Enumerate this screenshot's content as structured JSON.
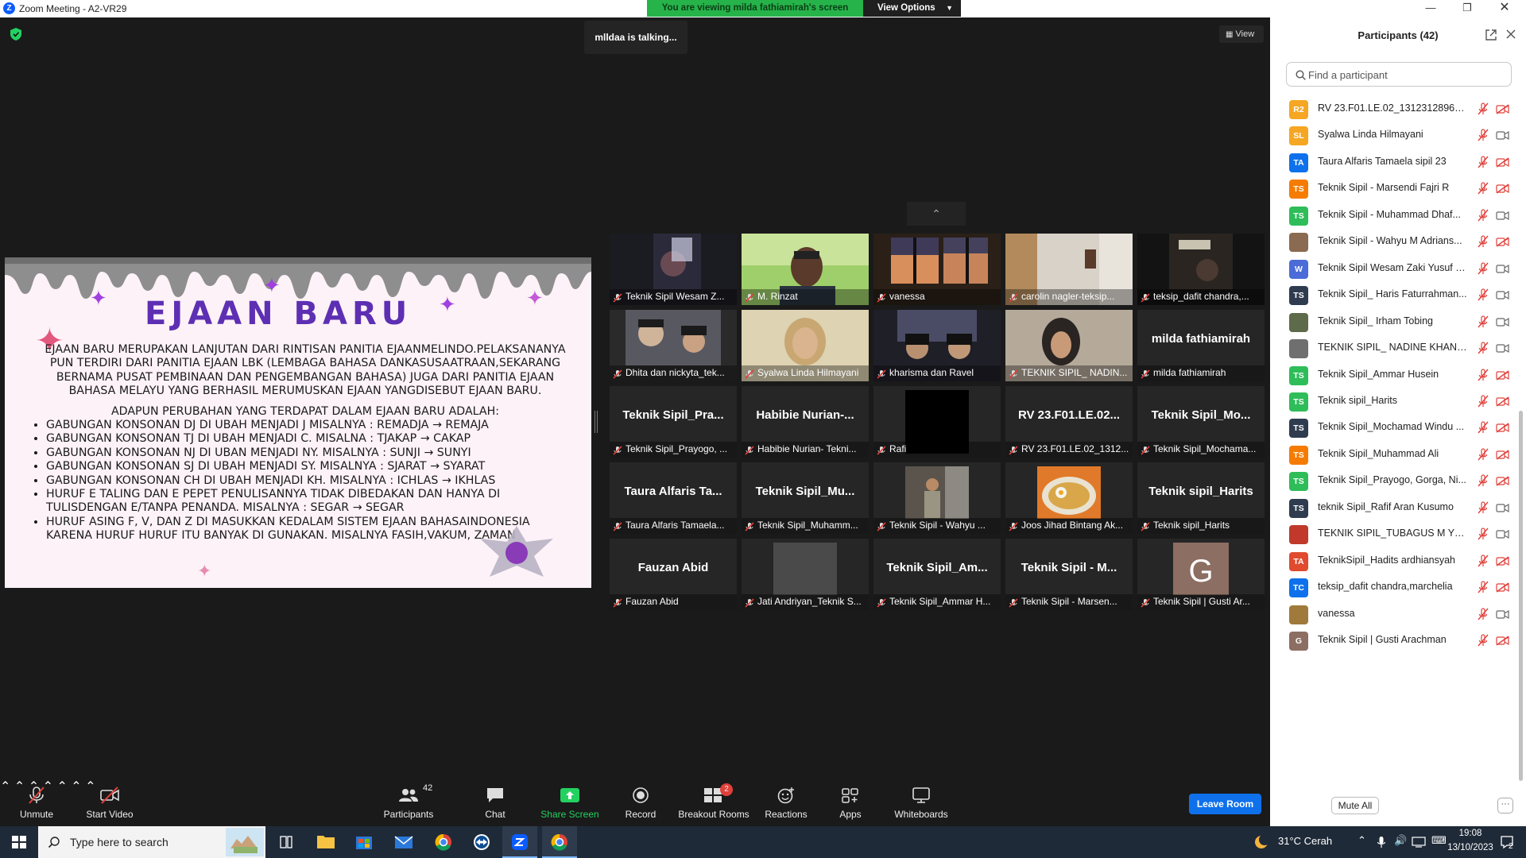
{
  "window": {
    "title": "Zoom Meeting - A2-VR29"
  },
  "banner": {
    "text": "You are viewing milda fathiamirah's screen",
    "view_options_label": "View Options"
  },
  "meeting": {
    "talking_text": "mlldaa is talking...",
    "view_label": "View"
  },
  "slide": {
    "title": "EJAAN BARU",
    "intro": "Ejaan baru merupakan lanjutan dari rintisan panitia ejaanmelindo.pelaksananya pun terdiri dari panitia ejaan LBK (lembaga bahasa dankasusaatraan,sekarang bernama pusat pembinaan dan pengembangan bahasa) juga dari panitia ejaan bahasa melayu yang berhasil merumuskan ejaan yangdisebut ejaan baru.",
    "lead": "Adapun perubahan yang terdapat dalam ejaan baru adalah:",
    "bullets": [
      "gabungan konsonan dj di ubah menjadi j misalnya : remadja → remaja",
      " gabungan konsonan tj di ubah menjadi c. misalna : tjakap → cakap",
      "gabungan konsonan nj di uban menjadi ny. misalnya : sunji → sunyi",
      "gabungan konsonan sj di ubah menjadi sy. misalnya : sjarat → syarat",
      "gabungan konsonan ch di ubah menjadi kh. misalnya : ichlas → ikhlas",
      "huruf e taling dan e pepet penulisannya tidak dibedakan dan hanya di tulisdengan e/tanpa penanda. misalnya : segar → segar",
      "huruf asing f, v, dan z di masukkan kedalam sistem ejaan bahasaindonesia karena huruf huruf itu banyak di gunakan. misalnya fasih,vakum, zaman"
    ]
  },
  "gallery": [
    [
      {
        "label": "Teknik Sipil Wesam Z...",
        "big": "",
        "video": "person-dark"
      },
      {
        "label": "M. Rinzat",
        "big": "",
        "video": "person-green"
      },
      {
        "label": "vanessa",
        "big": "",
        "video": "window-sunset"
      },
      {
        "label": "carolin nagler-teksip...",
        "big": "",
        "video": "room-wall"
      },
      {
        "label": "teksip_dafit chandra,...",
        "big": "",
        "video": "dark-room"
      }
    ],
    [
      {
        "label": "Dhita dan nickyta_tek...",
        "big": "",
        "video": "two-people"
      },
      {
        "label": "Syalwa Linda Hilmayani",
        "big": "",
        "video": "hijab-light"
      },
      {
        "label": "kharisma dan Ravel",
        "big": "",
        "video": "two-people-night"
      },
      {
        "label": "TEKNIK SIPIL_ NADIN...",
        "big": "",
        "video": "hijab-room"
      },
      {
        "label": "milda fathiamirah",
        "big": "milda fathiamirah",
        "video": ""
      }
    ],
    [
      {
        "label": "Teknik Sipil_Prayogo, ...",
        "big": "Teknik  Sipil_Pra...",
        "video": ""
      },
      {
        "label": "Habibie Nurian- Tekni...",
        "big": "Habibie  Nurian-...",
        "video": ""
      },
      {
        "label": "Rafi",
        "big": "",
        "video": "black"
      },
      {
        "label": "RV 23.F01.LE.02_1312...",
        "big": "RV 23.F01.LE.02...",
        "video": ""
      },
      {
        "label": "Teknik Sipil_Mochama...",
        "big": "Teknik  Sipil_Mo...",
        "video": ""
      }
    ],
    [
      {
        "label": "Taura Alfaris Tamaela...",
        "big": "Taura Alfaris Ta...",
        "video": ""
      },
      {
        "label": "Teknik Sipil_Muhamm...",
        "big": "Teknik  Sipil_Mu...",
        "video": ""
      },
      {
        "label": "Teknik Sipil - Wahyu ...",
        "big": "",
        "video": "person-standing"
      },
      {
        "label": "Joos Jihad Bintang Ak...",
        "big": "",
        "video": "food-bowl"
      },
      {
        "label": "Teknik sipil_Harits",
        "big": "Teknik sipil_Harits",
        "video": ""
      }
    ],
    [
      {
        "label": "Fauzan Abid",
        "big": "Fauzan Abid",
        "video": ""
      },
      {
        "label": "Jati Andriyan_Teknik S...",
        "big": "",
        "video": "grey-blur"
      },
      {
        "label": "Teknik Sipil_Ammar H...",
        "big": "Teknik  Sipil_Am...",
        "video": ""
      },
      {
        "label": "Teknik Sipil - Marsen...",
        "big": "Teknik  Sipil  -  M...",
        "video": ""
      },
      {
        "label": "Teknik Sipil | Gusti Ar...",
        "big": "",
        "video": "avatar-g"
      }
    ]
  ],
  "toolbar": {
    "unmute": "Unmute",
    "start_video": "Start Video",
    "participants": "Participants",
    "participants_count": "42",
    "chat": "Chat",
    "share_screen": "Share Screen",
    "record": "Record",
    "breakout_rooms": "Breakout Rooms",
    "breakout_badge": "2",
    "reactions": "Reactions",
    "apps": "Apps",
    "whiteboards": "Whiteboards",
    "leave_room": "Leave Room"
  },
  "panel": {
    "title": "Participants (42)",
    "search_placeholder": "Find a participant",
    "mute_all": "Mute All",
    "more": "···",
    "participants": [
      {
        "initials": "R2",
        "color": "#f5a623",
        "name": "RV 23.F01.LE.02_1312312896_Bl...",
        "cam": "off"
      },
      {
        "initials": "SL",
        "color": "#f5a623",
        "name": "Syalwa Linda Hilmayani",
        "cam": "on"
      },
      {
        "initials": "TA",
        "color": "#0e71eb",
        "name": "Taura Alfaris Tamaela sipil 23",
        "cam": "off"
      },
      {
        "initials": "TS",
        "color": "#f57c00",
        "name": "Teknik Sipil - Marsendi Fajri R",
        "cam": "off"
      },
      {
        "initials": "TS",
        "color": "#2ebd59",
        "name": "Teknik Sipil - Muhammad Dhaf...",
        "cam": "on"
      },
      {
        "initials": "",
        "color": "#8a6a50",
        "name": "Teknik Sipil - Wahyu M Adrians...",
        "cam": "off"
      },
      {
        "initials": "W",
        "color": "#4a6bd8",
        "name": "Teknik Sipil Wesam Zaki Yusuf S...",
        "cam": "on"
      },
      {
        "initials": "TS",
        "color": "#2f3c4f",
        "name": "Teknik Sipil_ Haris Faturrahman...",
        "cam": "on"
      },
      {
        "initials": "",
        "color": "#5d6b4b",
        "name": "Teknik Sipil_ Irham Tobing",
        "cam": "on"
      },
      {
        "initials": "",
        "color": "#6f6f6f",
        "name": "TEKNIK SIPIL_ NADINE KHANSA",
        "cam": "on"
      },
      {
        "initials": "TS",
        "color": "#2ebd59",
        "name": "Teknik Sipil_Ammar Husein",
        "cam": "off"
      },
      {
        "initials": "TS",
        "color": "#2ebd59",
        "name": "Teknik sipil_Harits",
        "cam": "off"
      },
      {
        "initials": "TS",
        "color": "#2f3c4f",
        "name": "Teknik Sipil_Mochamad Windu ...",
        "cam": "off"
      },
      {
        "initials": "TS",
        "color": "#f57c00",
        "name": "Teknik Sipil_Muhammad Ali",
        "cam": "off"
      },
      {
        "initials": "TS",
        "color": "#2ebd59",
        "name": "Teknik Sipil_Prayogo, Gorga, Ni...",
        "cam": "off"
      },
      {
        "initials": "TS",
        "color": "#2f3c4f",
        "name": "teknik Sipil_Rafif Aran Kusumo",
        "cam": "on"
      },
      {
        "initials": "",
        "color": "#c0392b",
        "name": "TEKNIK SIPIL_TUBAGUS M YUS...",
        "cam": "on"
      },
      {
        "initials": "TA",
        "color": "#e04a2f",
        "name": "TeknikSipil_Hadits ardhiansyah",
        "cam": "off"
      },
      {
        "initials": "TC",
        "color": "#0e71eb",
        "name": "teksip_dafit chandra,marchelia",
        "cam": "off"
      },
      {
        "initials": "",
        "color": "#a07a3a",
        "name": "vanessa",
        "cam": "on"
      },
      {
        "initials": "G",
        "color": "#8d6e63",
        "name": "Teknik Sipil | Gusti Arachman",
        "cam": "off"
      }
    ]
  },
  "taskbar": {
    "search_placeholder": "Type here to search",
    "weather": "31°C  Cerah",
    "time": "19:08",
    "date": "13/10/2023",
    "notification_count": "2"
  }
}
